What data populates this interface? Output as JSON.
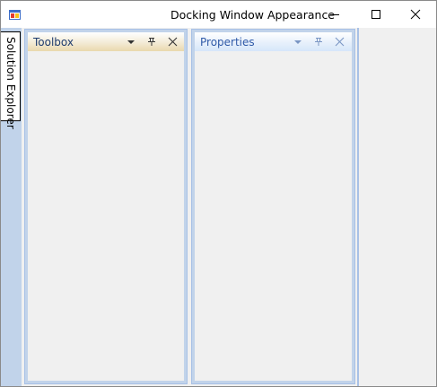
{
  "window": {
    "title": "Docking Window Appearance"
  },
  "autohide": {
    "tab_label": "Solution Explorer"
  },
  "panels": [
    {
      "title": "Toolbox"
    },
    {
      "title": "Properties"
    }
  ],
  "colors": {
    "dock_accent": "#c1d3ea",
    "toolbox_header": "#e9d8ad",
    "properties_header": "#d6e6fa"
  }
}
